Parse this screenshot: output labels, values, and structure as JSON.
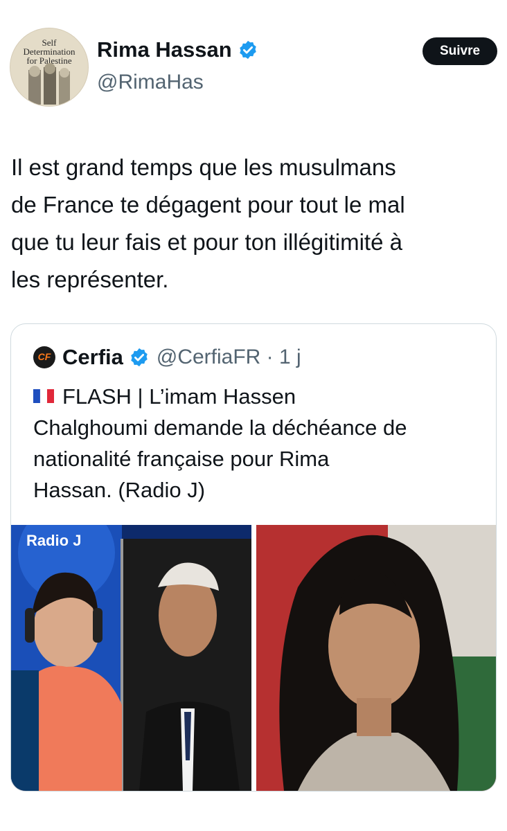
{
  "author": {
    "display_name": "Rima Hassan",
    "handle": "@RimaHas",
    "avatar_text": "Self\nDetermination\nfor Palestine",
    "follow_label": "Suivre"
  },
  "tweet": {
    "text": "Il est grand temps que les musulmans\nde France te dégagent pour tout le mal\nque tu leur fais et pour ton illégitimité à\nles représenter."
  },
  "quote": {
    "logo_text": "CF",
    "display_name": "Cerfia",
    "handle_time": "@CerfiaFR · 1 j",
    "text": "FLASH | L’imam Hassen\nChalghoumi demande la déchéance de\nnationalité française pour Rima\nHassan. (Radio J)",
    "media_left_text": "Radio J"
  },
  "colors": {
    "accent_blue": "#1d9bf0",
    "text_primary": "#0f1419",
    "text_secondary": "#536471",
    "border": "#cfd9de"
  }
}
